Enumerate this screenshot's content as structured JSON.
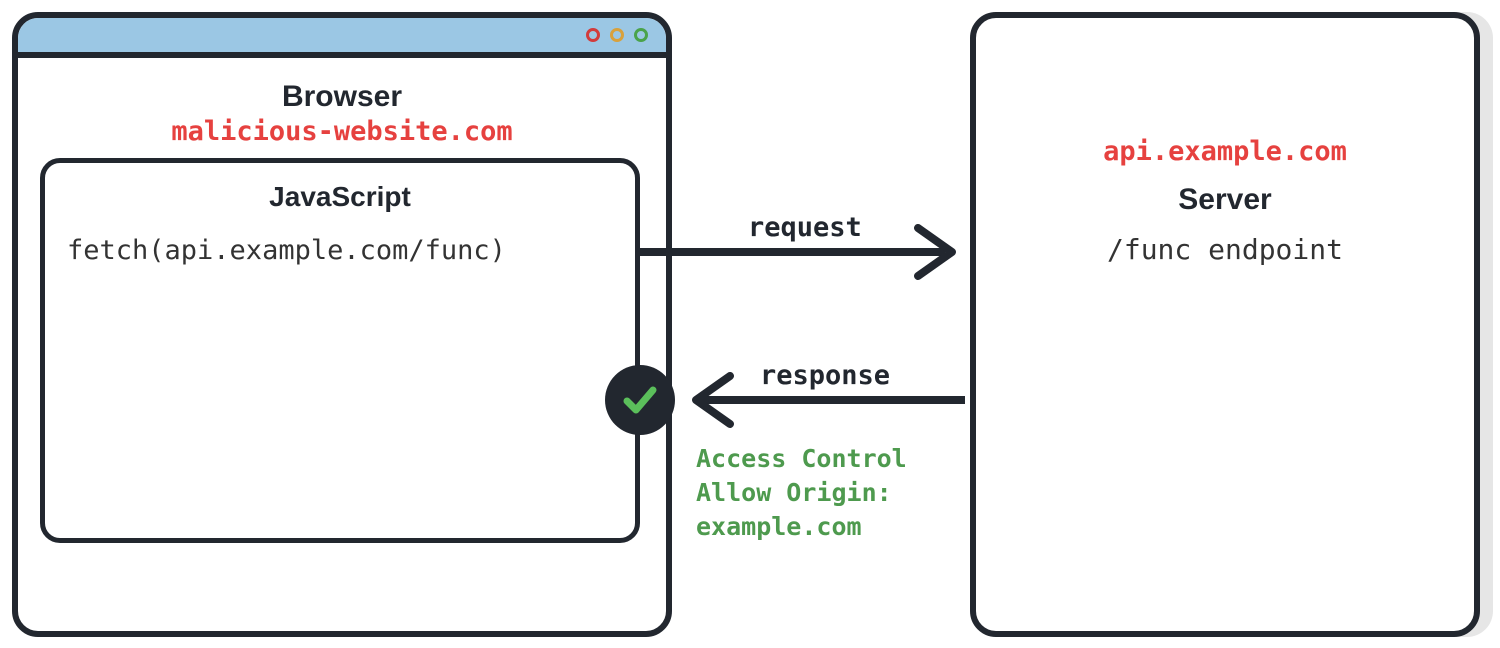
{
  "browser": {
    "title": "Browser",
    "origin": "malicious-website.com",
    "js": {
      "title": "JavaScript",
      "code": "fetch(api.example.com/func)"
    }
  },
  "server": {
    "domain": "api.example.com",
    "title": "Server",
    "endpoint": "/func endpoint"
  },
  "request": {
    "label": "request"
  },
  "response": {
    "label": "response",
    "status": "allowed",
    "header_lines": {
      "l1": "Access Control",
      "l2": "Allow Origin:",
      "l3": "example.com"
    }
  },
  "colors": {
    "stroke": "#22272f",
    "titlebar": "#9bc7e4",
    "danger": "#e6413f",
    "ok": "#4e9a4e"
  }
}
